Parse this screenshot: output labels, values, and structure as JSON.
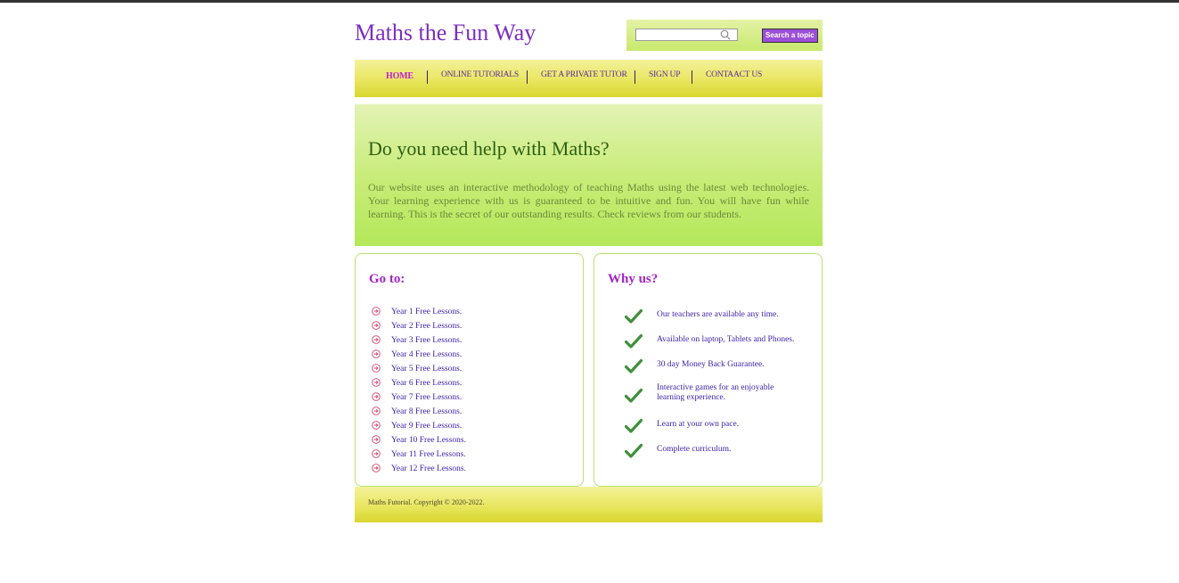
{
  "header": {
    "title": "Maths the Fun Way",
    "search_value": "",
    "search_button": "Search a topic"
  },
  "nav": {
    "items": [
      {
        "label": "HOME",
        "active": true
      },
      {
        "label": "ONLINE TUTORIALS",
        "active": false
      },
      {
        "label": "GET A PRIVATE TUTOR",
        "active": false
      },
      {
        "label": "SIGN UP",
        "active": false
      },
      {
        "label": "CONTAACT US",
        "active": false
      }
    ]
  },
  "hero": {
    "title": "Do you need help with Maths?",
    "text": "Our website uses an interactive methodology of teaching Maths using the latest web technologies. Your learning experience with us is guaranteed to be intuitive and fun. You will have fun while learning. This is the secret of our outstanding results. Check reviews from our students."
  },
  "goto": {
    "title": "Go to:",
    "items": [
      "Year 1 Free Lessons.",
      "Year 2 Free Lessons.",
      "Year 3 Free Lessons.",
      "Year 4 Free Lessons.",
      "Year 5 Free Lessons.",
      "Year 6 Free Lessons.",
      "Year 7 Free Lessons.",
      "Year 8 Free Lessons.",
      "Year 9 Free Lessons.",
      "Year 10 Free Lessons.",
      "Year 11 Free Lessons.",
      "Year 12 Free Lessons."
    ]
  },
  "why": {
    "title": "Why us?",
    "items": [
      "Our teachers are available any time.",
      "Available on laptop, Tablets and Phones.",
      "30 day Money Back Guarantee.",
      "Interactive games for an enjoyable learning experience.",
      "Learn at your own pace.",
      "Complete curriculum."
    ]
  },
  "footer": {
    "text": "Maths Futorial. Copyright © 2020-2022."
  },
  "colors": {
    "brand": "#7b2fbf",
    "accent": "#c21fd0",
    "check": "#3f8f3a"
  }
}
